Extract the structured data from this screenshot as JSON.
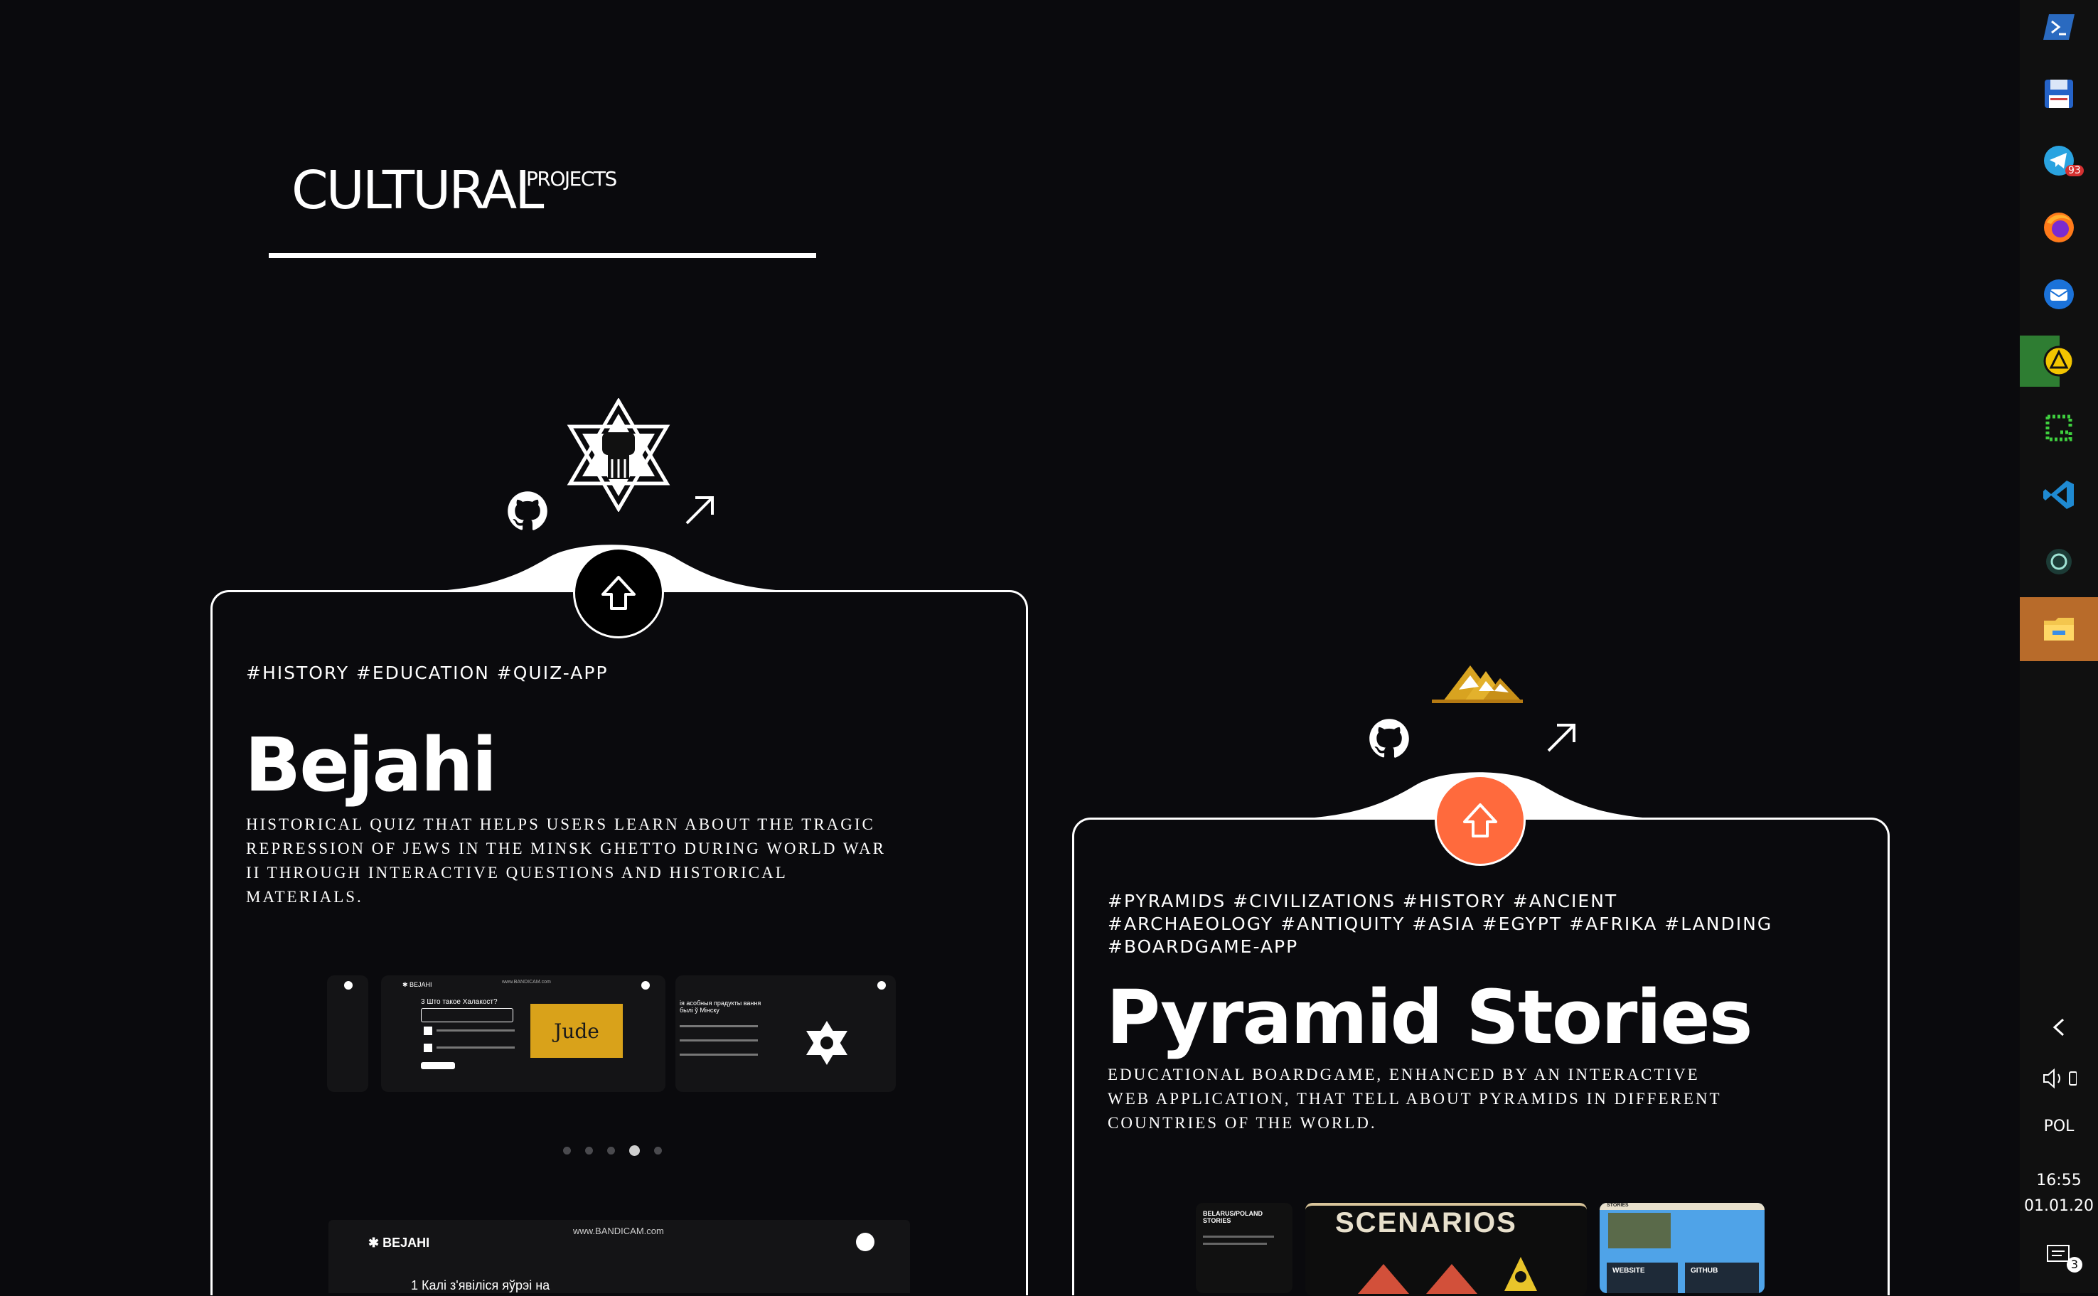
{
  "section": {
    "title": "CULTURAL",
    "superscript": "PROJECTS"
  },
  "projects": [
    {
      "tags": "#HISTORY #EDUCATION #QUIZ-APP",
      "title": "Bejahi",
      "description": "Historical quiz that helps users learn about the tragic repression of Jews in the Minsk Ghetto during World War II through interactive questions and historical materials.",
      "accent": "#000000",
      "icons": {
        "logo": "star-of-david-fist-icon",
        "repo": "github-icon",
        "external": "arrow-up-right-icon",
        "scroll": "arrow-up-icon"
      },
      "carousel": {
        "slides": [
          {
            "brand": "✱ BEJAHI",
            "url": "www.BANDICAM.com",
            "heading": "3 Што такое Халакост?",
            "badge": "Jude"
          },
          {
            "heading": "ія асобныя прадукты вання былі ў Мінску"
          }
        ],
        "dots": 5,
        "active_dot": 3
      },
      "preview": {
        "brand": "✱ BEJAHI",
        "url": "www.BANDICAM.com",
        "text": "1 Калі з'явіліся яўрэі на"
      }
    },
    {
      "tags": "#PYRAMIDS #CIVILIZATIONS #HISTORY #ANCIENT #ARCHAEOLOGY #ANTIQUITY #ASIA #EGYPT #AFRIKA #LANDING #BOARDGAME-APP",
      "title": "Pyramid Stories",
      "description": "Educational boardgame, enhanced by an interactive web application, that tell about pyramids in different countries of the world.",
      "accent": "#ff6a3d",
      "icons": {
        "logo": "pyramids-icon",
        "repo": "github-icon",
        "external": "arrow-up-right-icon",
        "scroll": "arrow-up-icon"
      },
      "carousel": {
        "slides": [
          {
            "heading": "BELARUS/POLAND STORIES"
          },
          {
            "heading": "SCENARIOS"
          },
          {
            "heading": "STORIES",
            "buttons": [
              "WEBSITE",
              "GITHUB"
            ]
          }
        ]
      }
    }
  ],
  "taskbar": {
    "apps": [
      "powershell-icon",
      "floppy-disk-icon",
      "telegram-icon",
      "firefox-icon",
      "thunderbird-icon",
      "arch-launcher-icon",
      "grid-app-icon",
      "vscode-icon",
      "chatgpt-icon",
      "file-explorer-icon"
    ],
    "telegram_badge": "93",
    "tray": {
      "chevron": "chevron-left-icon",
      "volume": "volume-icon",
      "language": "POL",
      "time": "16:55",
      "date": "01.01.20",
      "notifications_count": "3"
    }
  }
}
